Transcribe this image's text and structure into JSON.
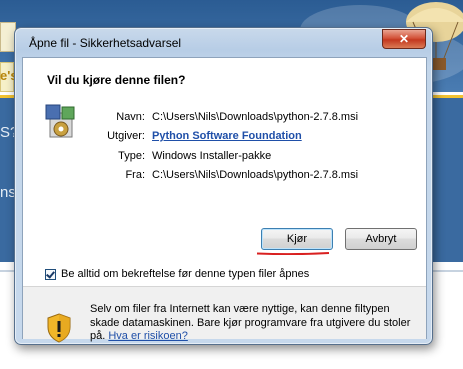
{
  "background": {
    "fragment_1": "e's",
    "fragment_2": "S? F",
    "fragment_3": "ns"
  },
  "dialog": {
    "title": "Åpne fil - Sikkerhetsadvarsel",
    "close_glyph": "✕",
    "question": "Vil du kjøre denne filen?",
    "fields": {
      "name_label": "Navn:",
      "name_value": "C:\\Users\\Nils\\Downloads\\python-2.7.8.msi",
      "publisher_label": "Utgiver:",
      "publisher_value": "Python Software Foundation",
      "type_label": "Type:",
      "type_value": "Windows Installer-pakke",
      "from_label": "Fra:",
      "from_value": "C:\\Users\\Nils\\Downloads\\python-2.7.8.msi"
    },
    "buttons": {
      "run": "Kjør",
      "cancel": "Avbryt"
    },
    "checkbox": {
      "label": "Be alltid om bekreftelse før denne typen filer åpnes",
      "checked": true
    },
    "warning": {
      "text": "Selv om filer fra Internett kan være nyttige, kan denne filtypen skade datamaskinen. Bare kjør programvare fra utgivere du stoler på.",
      "link": "Hva er risikoen?"
    }
  },
  "colors": {
    "link": "#1f4fa8",
    "annotation_underline": "#d92020",
    "site_header": "#2b5c93"
  }
}
